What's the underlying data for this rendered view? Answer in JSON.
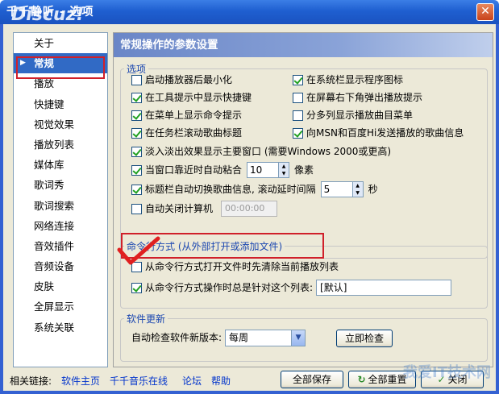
{
  "window": {
    "title": "千千静听 - 选项",
    "watermark": "Discuz!",
    "close": "✕"
  },
  "sidebar": {
    "items": [
      {
        "label": "关于"
      },
      {
        "label": "常规",
        "active": true
      },
      {
        "label": "播放"
      },
      {
        "label": "快捷键"
      },
      {
        "label": "视觉效果"
      },
      {
        "label": "播放列表"
      },
      {
        "label": "媒体库"
      },
      {
        "label": "歌词秀"
      },
      {
        "label": "歌词搜索"
      },
      {
        "label": "网络连接"
      },
      {
        "label": "音效插件"
      },
      {
        "label": "音频设备"
      },
      {
        "label": "皮肤"
      },
      {
        "label": "全屏显示"
      },
      {
        "label": "系统关联"
      }
    ]
  },
  "panel": {
    "title": "常规操作的参数设置",
    "options": {
      "legend": "选项",
      "minimize_on_start": {
        "label": "启动播放器后最小化",
        "checked": false
      },
      "tray_icon": {
        "label": "在系统栏显示程序图标",
        "checked": true
      },
      "tooltip_hotkeys": {
        "label": "在工具提示中显示快捷键",
        "checked": true
      },
      "bottom_right_popup": {
        "label": "在屏幕右下角弹出播放提示",
        "checked": false
      },
      "menu_tips": {
        "label": "在菜单上显示命令提示",
        "checked": true
      },
      "multi_column_menu": {
        "label": "分多列显示播放曲目菜单",
        "checked": false
      },
      "taskbar_scroll": {
        "label": "在任务栏滚动歌曲标题",
        "checked": true
      },
      "send_to_msn": {
        "label": "向MSN和百度Hi发送播放的歌曲信息",
        "checked": true
      },
      "fade_effect": {
        "label": "淡入淡出效果显示主要窗口 (需要Windows 2000或更高)",
        "checked": true
      },
      "snap_edge": {
        "label": "当窗口靠近时自动粘合",
        "checked": true,
        "value": "10",
        "unit": "像素"
      },
      "title_scroll": {
        "label": "标题栏自动切换歌曲信息, 滚动延时间隔",
        "checked": true,
        "value": "5",
        "unit": "秒"
      },
      "auto_shutdown": {
        "label": "自动关闭计算机",
        "checked": false,
        "time": "00:00:00"
      }
    },
    "cmdline": {
      "legend": "命令行方式 (从外部打开或添加文件)",
      "clear_list": {
        "label": "从命令行方式打开文件时先清除当前播放列表",
        "checked": false
      },
      "target_list": {
        "label": "从命令行方式操作时总是针对这个列表:",
        "checked": true,
        "value": "[默认]"
      }
    },
    "update": {
      "legend": "软件更新",
      "label": "自动检查软件新版本:",
      "frequency": "每周",
      "check_now": "立即检查"
    }
  },
  "footer": {
    "label": "相关链接:",
    "links": [
      "软件主页",
      "千千音乐在线",
      "论坛",
      "帮助"
    ],
    "save_all": "全部保存",
    "reset_all": "全部重置",
    "close": "关闭",
    "site_watermark": "我爱IT技术网"
  }
}
